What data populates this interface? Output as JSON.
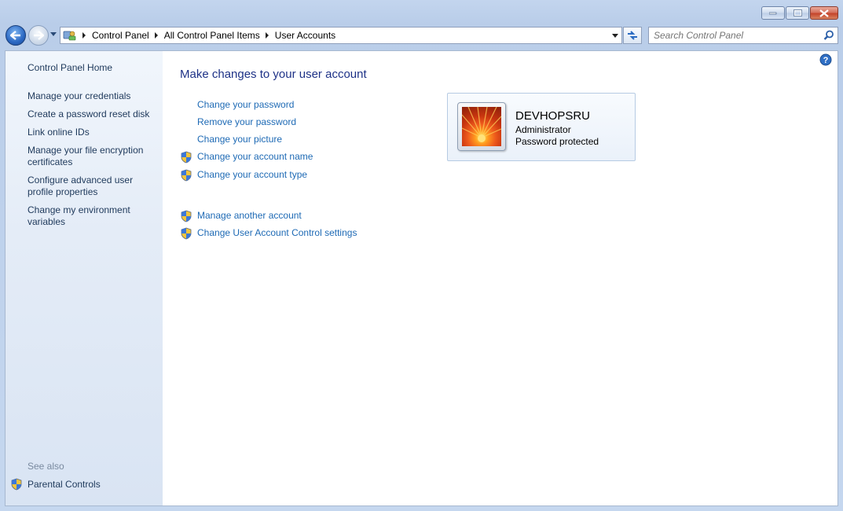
{
  "window": {
    "caption_buttons": [
      "minimize",
      "maximize",
      "close"
    ]
  },
  "address_bar": {
    "breadcrumbs": [
      "Control Panel",
      "All Control Panel Items",
      "User Accounts"
    ]
  },
  "search": {
    "placeholder": "Search Control Panel"
  },
  "sidebar": {
    "home": "Control Panel Home",
    "items": [
      {
        "label": "Manage your credentials"
      },
      {
        "label": "Create a password reset disk"
      },
      {
        "label": "Link online IDs"
      },
      {
        "label": "Manage your file encryption certificates"
      },
      {
        "label": "Configure advanced user profile properties"
      },
      {
        "label": "Change my environment variables"
      }
    ],
    "see_also_label": "See also",
    "see_also_items": [
      {
        "label": "Parental Controls"
      }
    ]
  },
  "main": {
    "title": "Make changes to your user account",
    "links": [
      {
        "label": "Change your password",
        "shield": false
      },
      {
        "label": "Remove your password",
        "shield": false
      },
      {
        "label": "Change your picture",
        "shield": false
      },
      {
        "label": "Change your account name",
        "shield": true
      },
      {
        "label": "Change your account type",
        "shield": true
      }
    ],
    "more_links": [
      {
        "label": "Manage another account",
        "shield": true
      },
      {
        "label": "Change User Account Control settings",
        "shield": true
      }
    ]
  },
  "user": {
    "name": "DEVHOPSRU",
    "role": "Administrator",
    "status": "Password protected"
  },
  "colors": {
    "link": "#1e6ab5",
    "title": "#1e3287",
    "sidebar_text": "#1e395b"
  }
}
